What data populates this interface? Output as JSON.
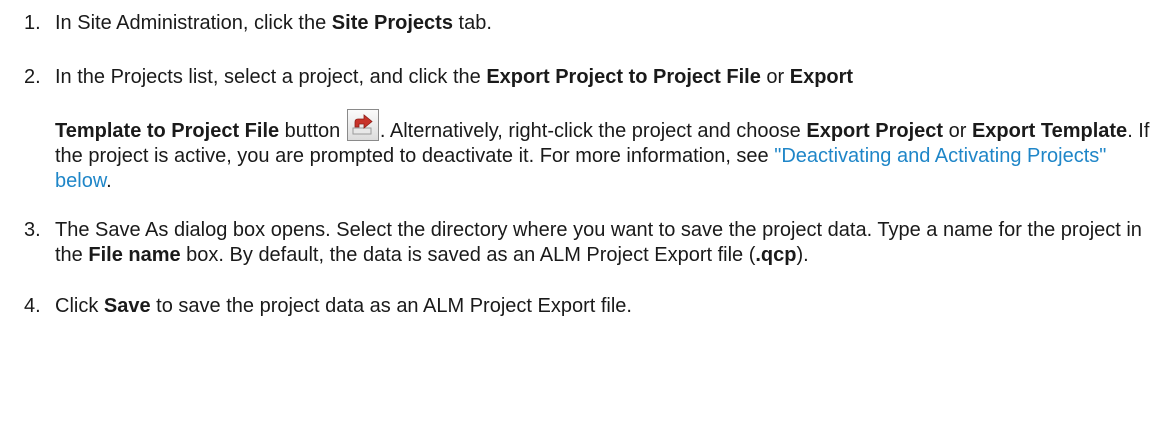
{
  "steps": [
    {
      "num": "1.",
      "t1": "In Site Administration, click the ",
      "b1": "Site Projects",
      "t2": " tab."
    },
    {
      "num": "2.",
      "t1": "In the Projects list, select a project, and click the ",
      "b1": "Export Project to Project File",
      "t2": " or ",
      "b2": "Export",
      "b3": "Template to Project File",
      "t3": " button ",
      "t4": ". Alternatively, right-click the project and choose ",
      "b4": "Export Project",
      "t5": " or ",
      "b5": "Export Template",
      "t6": ". If the project is active, you are prompted to deactivate it. For more information, see ",
      "link": "\"Deactivating and Activating Projects\" below",
      "t7": ".",
      "button_icon": "export-project-icon"
    },
    {
      "num": "3.",
      "t1": "The Save As dialog box opens. Select the directory where you want to save the project data. Type a name for the project in the ",
      "b1": "File name",
      "t2": " box. By default, the data is saved as an ALM Project Export file (",
      "b2": ".qcp",
      "t3": ")."
    },
    {
      "num": "4.",
      "t1": "Click ",
      "b1": "Save",
      "t2": " to save the project data as an ALM Project Export file."
    }
  ],
  "colors": {
    "text": "#1a1a1a",
    "link": "#1f86c8",
    "icon_arrow": "#c8332a"
  }
}
